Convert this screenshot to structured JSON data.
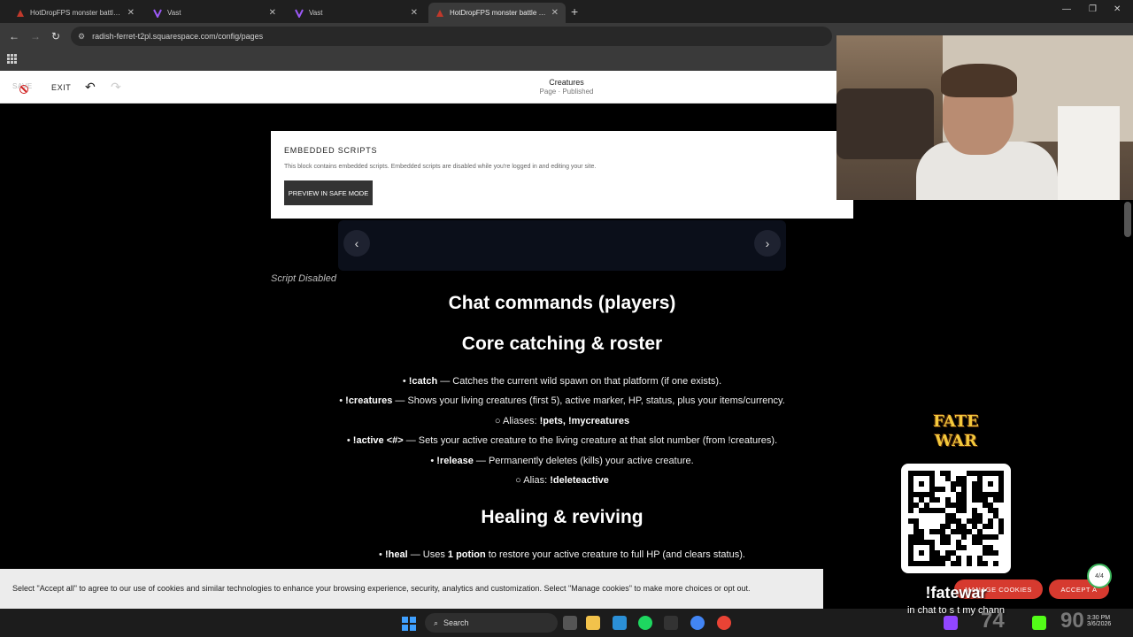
{
  "tabs": [
    {
      "title": "HotDropFPS monster battle style",
      "active": false
    },
    {
      "title": "Vast",
      "active": false
    },
    {
      "title": "Vast",
      "active": false
    },
    {
      "title": "HotDropFPS monster battle style",
      "active": true
    }
  ],
  "address": {
    "url": "radish-ferret-t2pl.squarespace.com/config/pages"
  },
  "editor": {
    "save_label": "SAVE",
    "exit_label": "EXIT",
    "page_title": "Creatures",
    "page_status": "Page · Published"
  },
  "embed": {
    "heading": "EMBEDDED SCRIPTS",
    "description": "This block contains embedded scripts. Embedded scripts are disabled while you're logged in and editing your site.",
    "button": "PREVIEW IN SAFE MODE"
  },
  "carousel": {
    "prev": "‹",
    "next": "›"
  },
  "script_disabled": "Script Disabled",
  "content": {
    "h_players": "Chat commands (players)",
    "h_core": "Core catching & roster",
    "catch_cmd": "!catch",
    "catch_text": " — Catches the current wild spawn on that platform (if one exists).",
    "creatures_cmd": "!creatures",
    "creatures_text": " — Shows your living creatures (first 5), active marker, HP, status, plus your items/currency.",
    "aliases_label": "Aliases: ",
    "aliases_cmds": "!pets, !mycreatures",
    "active_cmd": "!active <#>",
    "active_text": " — Sets your active creature to the living creature at that slot number (from !creatures).",
    "release_cmd": "!release",
    "release_text": " — Permanently deletes (kills) your active creature.",
    "alias_label": "Alias: ",
    "alias_cmd": "!deleteactive",
    "h_heal": "Healing & reviving",
    "heal_cmd": "!heal",
    "heal_pre": " — Uses ",
    "heal_amt": "1 potion",
    "heal_post": " to restore your active creature to full HP (and clears status)."
  },
  "cookie": {
    "text": "Select \"Accept all\" to agree to our use of cookies and similar technologies to enhance your browsing experience, security, analytics and customization. Select \"Manage cookies\" to make more choices or opt out.",
    "manage": "MANAGE COOKIES",
    "accept": "ACCEPT A"
  },
  "taskbar": {
    "search": "Search",
    "time": "3:30 PM",
    "date": "3/6/2026"
  },
  "overlay": {
    "logo": "FATE WAR",
    "command": "!fatewar",
    "subtext": "in chat to s    t my chann",
    "counter": "4/4",
    "num1": "74",
    "num2": "90"
  },
  "colors": {
    "accent_red": "#d63a2f",
    "brand_gold": "#f4c93c"
  }
}
